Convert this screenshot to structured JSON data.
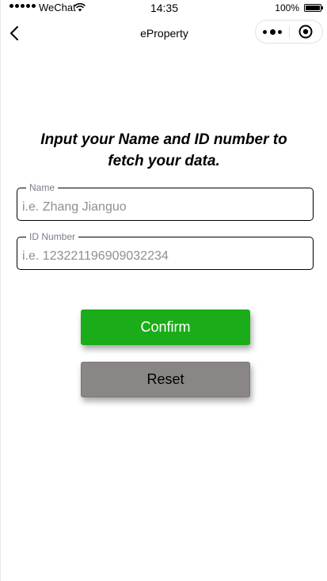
{
  "status_bar": {
    "carrier": "WeChat",
    "time": "14:35",
    "battery": "100%",
    "battery_level": 1.0
  },
  "nav_bar": {
    "title": "eProperty",
    "back_icon": "chevron-left-icon",
    "more_icon": "more-dots-icon",
    "close_icon": "target-circle-icon"
  },
  "form": {
    "heading": "Input your Name and ID number to fetch your data.",
    "name": {
      "label": "Name",
      "placeholder": "i.e. Zhang Jianguo",
      "value": ""
    },
    "id_number": {
      "label": "ID Number",
      "placeholder": "i.e. 123221196909032234",
      "value": ""
    }
  },
  "buttons": {
    "confirm_label": "Confirm",
    "reset_label": "Reset"
  },
  "colors": {
    "confirm_bg": "#1aad19",
    "reset_bg": "#8a8686",
    "label_color": "#7d7d8c"
  }
}
